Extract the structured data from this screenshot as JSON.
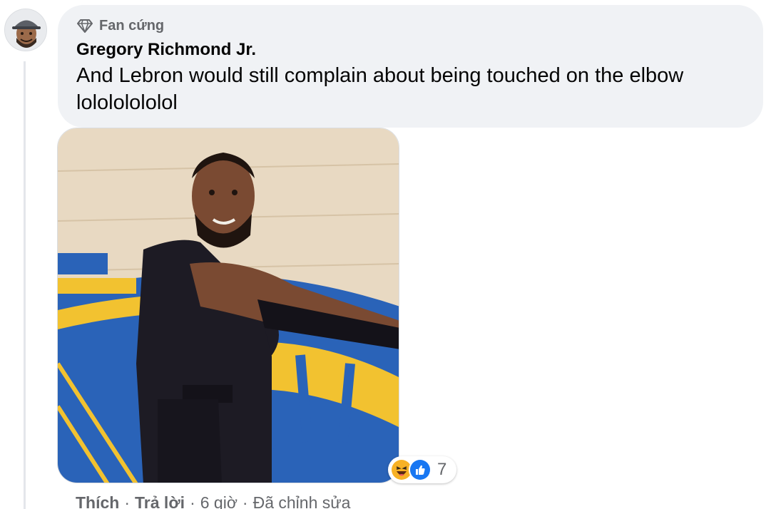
{
  "comment": {
    "badge_label": "Fan cứng",
    "author": "Gregory Richmond Jr.",
    "text": "And Lebron would still complain about being touched on the elbow lolololololol"
  },
  "reactions": {
    "types": [
      "haha",
      "like"
    ],
    "count": "7",
    "colors": {
      "haha": "#f7b125",
      "like": "#1877f2"
    }
  },
  "actions": {
    "like": "Thích",
    "reply": "Trả lời",
    "time": "6 giờ",
    "edited": "Đã chỉnh sửa",
    "separator": "·"
  }
}
